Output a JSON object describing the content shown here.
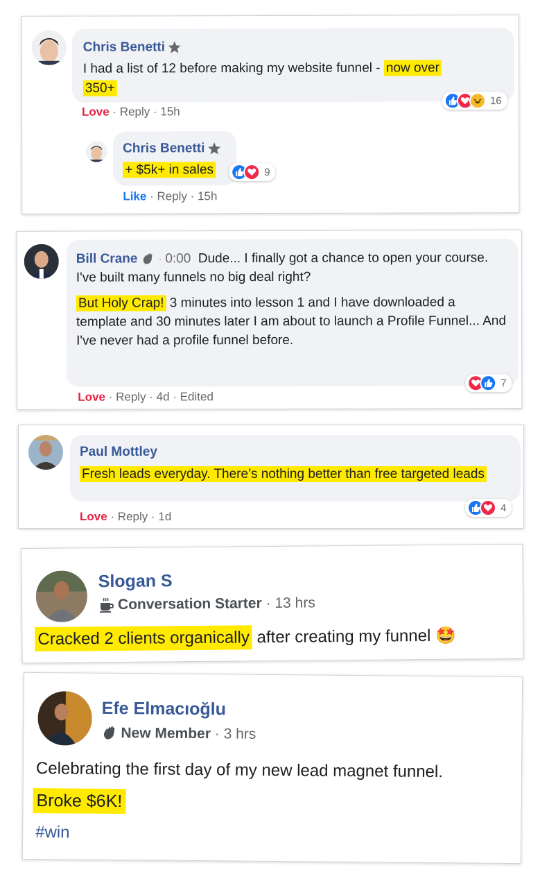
{
  "comment1": {
    "author": "Chris Benetti",
    "text_before": "I had a list of 12 before making my website funnel - ",
    "highlight_a": "now over",
    "highlight_b": "350+",
    "action_love": "Love",
    "action_reply": "Reply",
    "time": "15h",
    "reaction_count": "16",
    "reactions": [
      "like-icon",
      "love-icon",
      "haha-icon"
    ]
  },
  "reply1": {
    "author": "Chris Benetti",
    "highlight": "+ $5k+ in sales",
    "action_like": "Like",
    "action_reply": "Reply",
    "time": "15h",
    "reaction_count": "9",
    "reactions": [
      "like-icon",
      "love-icon"
    ]
  },
  "comment2": {
    "author": "Bill Crane",
    "timestamp": "0:00",
    "text_1": "Dude... I finally got a chance to open your course. I've built many funnels no big deal right?",
    "highlight": "But Holy Crap!",
    "text_2": " 3 minutes into lesson 1 and I have downloaded a template and 30 minutes later I am about to launch a Profile Funnel... And I've never had a profile funnel before.",
    "action_love": "Love",
    "action_reply": "Reply",
    "time": "4d",
    "edited": "Edited",
    "reaction_count": "7",
    "reactions": [
      "love-icon",
      "like-icon"
    ]
  },
  "comment3": {
    "author": "Paul Mottley",
    "highlight": "Fresh leads everyday. There’s nothing better than free targeted leads",
    "action_love": "Love",
    "action_reply": "Reply",
    "time": "1d",
    "reaction_count": "4",
    "reactions": [
      "like-icon",
      "love-icon"
    ]
  },
  "post1": {
    "author": "Slogan S",
    "badge": "Conversation Starter",
    "time": "13 hrs",
    "highlight": "Cracked 2 clients organically",
    "text": " after creating my funnel",
    "emoji": "🤩"
  },
  "post2": {
    "author": "Efe Elmacıoğlu",
    "badge": "New Member",
    "time": "3 hrs",
    "text": "Celebrating the first day of my new lead magnet funnel.",
    "highlight": "Broke $6K!",
    "hashtag": "#win"
  },
  "colors": {
    "name": "#385898",
    "highlight": "#ffea00",
    "love": "#e41e3f",
    "like": "#1877f2",
    "bubble": "#f0f2f5"
  }
}
